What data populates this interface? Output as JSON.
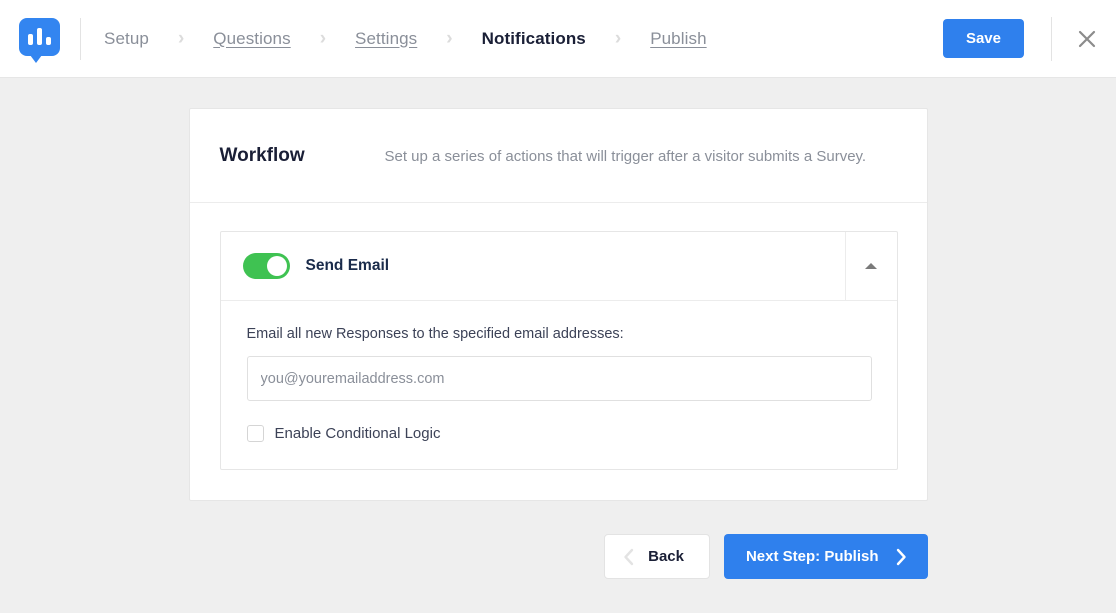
{
  "header": {
    "logo_icon": "bar-chart-bubble-logo",
    "breadcrumb": [
      {
        "label": "Setup",
        "state": "link-plain"
      },
      {
        "label": "Questions",
        "state": "link"
      },
      {
        "label": "Settings",
        "state": "link"
      },
      {
        "label": "Notifications",
        "state": "current"
      },
      {
        "label": "Publish",
        "state": "link"
      }
    ],
    "separator": "›",
    "save_label": "Save",
    "close_icon": "close-icon"
  },
  "card": {
    "title": "Workflow",
    "subtitle": "Set up a series of actions that will trigger after a visitor submits a Survey.",
    "panel": {
      "toggle_on": true,
      "label": "Send Email",
      "collapse_icon": "caret-up-icon",
      "field_label": "Email all new Responses to the specified email addresses:",
      "email_placeholder": "you@youremailaddress.com",
      "email_value": "",
      "checkbox_checked": false,
      "checkbox_label": "Enable Conditional Logic"
    }
  },
  "footer": {
    "back_label": "Back",
    "next_label": "Next Step: Publish"
  },
  "colors": {
    "accent_blue": "#2f80ed",
    "logo_blue": "#3385f0",
    "toggle_green": "#3fc252",
    "page_background": "#efefef",
    "text_dark": "#1a1f36",
    "text_muted": "#8a8f99"
  }
}
